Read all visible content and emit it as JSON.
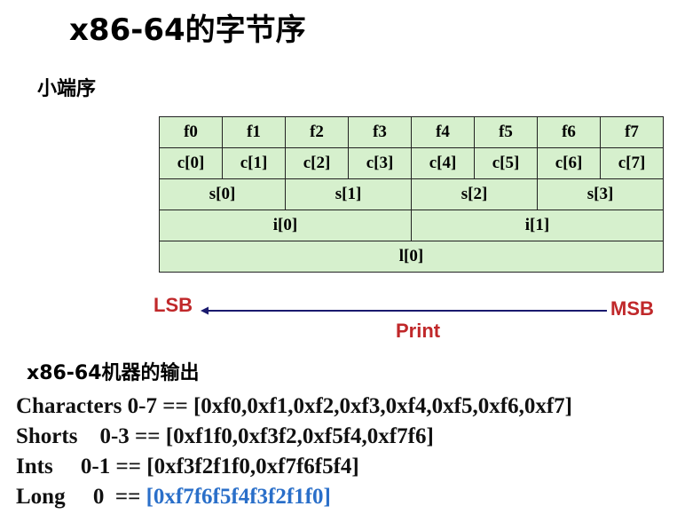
{
  "title": "x86-64的字节序",
  "subtitle": "小端序",
  "layout_table": {
    "chars": [
      "f0",
      "f1",
      "f2",
      "f3",
      "f4",
      "f5",
      "f6",
      "f7"
    ],
    "c": [
      "c[0]",
      "c[1]",
      "c[2]",
      "c[3]",
      "c[4]",
      "c[5]",
      "c[6]",
      "c[7]"
    ],
    "s": [
      "s[0]",
      "s[1]",
      "s[2]",
      "s[3]"
    ],
    "i": [
      "i[0]",
      "i[1]"
    ],
    "l": "l[0]"
  },
  "axis": {
    "lsb": "LSB",
    "msb": "MSB",
    "print": "Print"
  },
  "output": {
    "title": "x86-64机器的输出",
    "lines": [
      "Characters 0-7 == [0xf0,0xf1,0xf2,0xf3,0xf4,0xf5,0xf6,0xf7]",
      "Shorts    0-3 == [0xf1f0,0xf3f2,0xf5f4,0xf7f6]",
      "Ints     0-1 == [0xf3f2f1f0,0xf7f6f5f4]"
    ],
    "long_prefix": "Long     0  == ",
    "long_value": "[0xf7f6f5f4f3f2f1f0]"
  },
  "colors": {
    "cell_bg": "#d6f0cd",
    "axis_label": "#c0282a",
    "arrow": "#1a1a6e",
    "highlight": "#2a6fc9"
  }
}
